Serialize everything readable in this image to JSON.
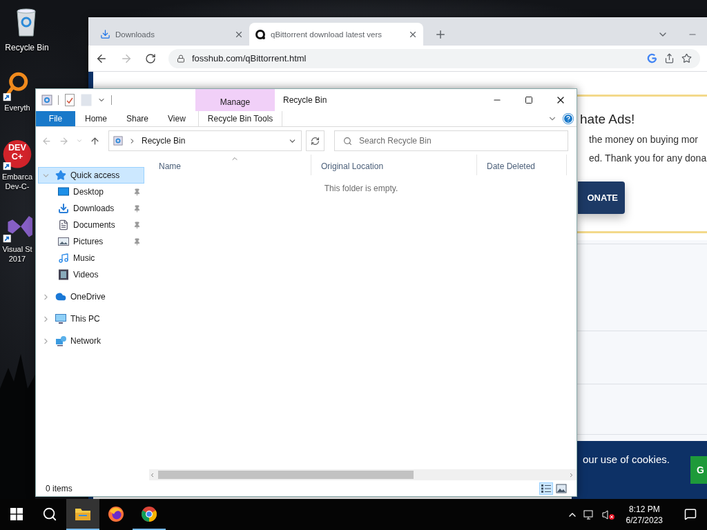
{
  "desktop": {
    "icons": [
      {
        "kind": "recycle-bin",
        "lines": [
          "Recycle Bin"
        ],
        "shortcut": false
      },
      {
        "kind": "magnifier",
        "lines": [
          "Everyth"
        ],
        "shortcut": true
      },
      {
        "kind": "dev",
        "lines": [
          "Embarca",
          "Dev-C-"
        ],
        "shortcut": true,
        "logo_text": [
          "DEV",
          "C+"
        ]
      },
      {
        "kind": "visual-studio",
        "lines": [
          "Visual St",
          "2017"
        ],
        "shortcut": true
      }
    ]
  },
  "browser": {
    "tabs": [
      {
        "kind": "downloads",
        "title": "Downloads",
        "selected": false
      },
      {
        "kind": "site",
        "title": "qBittorrent download latest vers",
        "selected": true
      }
    ],
    "address": "fosshub.com/qBittorrent.html",
    "page": {
      "heading": "hate Ads!",
      "lines": [
        "the money on buying mor",
        "ed. Thank you for any dona"
      ],
      "donate": "ONATE",
      "cookie_text": "our use of cookies.",
      "cookie_button": "G"
    }
  },
  "explorer": {
    "title": "Recycle Bin",
    "context_group": "Manage",
    "ribbon_tabs": [
      {
        "label": "File",
        "kind": "file"
      },
      {
        "label": "Home",
        "kind": "plain"
      },
      {
        "label": "Share",
        "kind": "plain"
      },
      {
        "label": "View",
        "kind": "plain"
      },
      {
        "label": "Recycle Bin Tools",
        "kind": "context"
      }
    ],
    "location": "Recycle Bin",
    "search_placeholder": "Search Recycle Bin",
    "nav": [
      {
        "label": "Quick access",
        "kind": "star",
        "expanded": true,
        "selected": true,
        "children": [
          {
            "label": "Desktop",
            "kind": "desktop",
            "pinned": true,
            "selected": false
          },
          {
            "label": "Downloads",
            "kind": "downloads",
            "pinned": true,
            "selected": false
          },
          {
            "label": "Documents",
            "kind": "documents",
            "pinned": true,
            "selected": false
          },
          {
            "label": "Pictures",
            "kind": "pictures",
            "pinned": true,
            "selected": false
          },
          {
            "label": "Music",
            "kind": "music",
            "pinned": false,
            "selected": false
          },
          {
            "label": "Videos",
            "kind": "videos",
            "pinned": false,
            "selected": false
          }
        ]
      },
      {
        "label": "OneDrive",
        "kind": "cloud",
        "expanded": false,
        "selected": false
      },
      {
        "label": "This PC",
        "kind": "pc",
        "expanded": false,
        "selected": false
      },
      {
        "label": "Network",
        "kind": "network",
        "expanded": false,
        "selected": false
      }
    ],
    "columns": [
      {
        "label": "Name",
        "sorted": true
      },
      {
        "label": "Original Location",
        "sorted": false
      },
      {
        "label": "Date Deleted",
        "sorted": false
      }
    ],
    "empty_message": "This folder is empty.",
    "status": "0 items",
    "view_modes": [
      {
        "kind": "details",
        "selected": true
      },
      {
        "kind": "large-icons",
        "selected": false
      }
    ]
  },
  "taskbar": {
    "apps": [
      {
        "kind": "explorer",
        "active": true,
        "running": true
      },
      {
        "kind": "firefox",
        "active": false,
        "running": false
      },
      {
        "kind": "chrome",
        "active": false,
        "running": true
      }
    ],
    "time": "8:12 PM",
    "date": "6/27/2023"
  }
}
